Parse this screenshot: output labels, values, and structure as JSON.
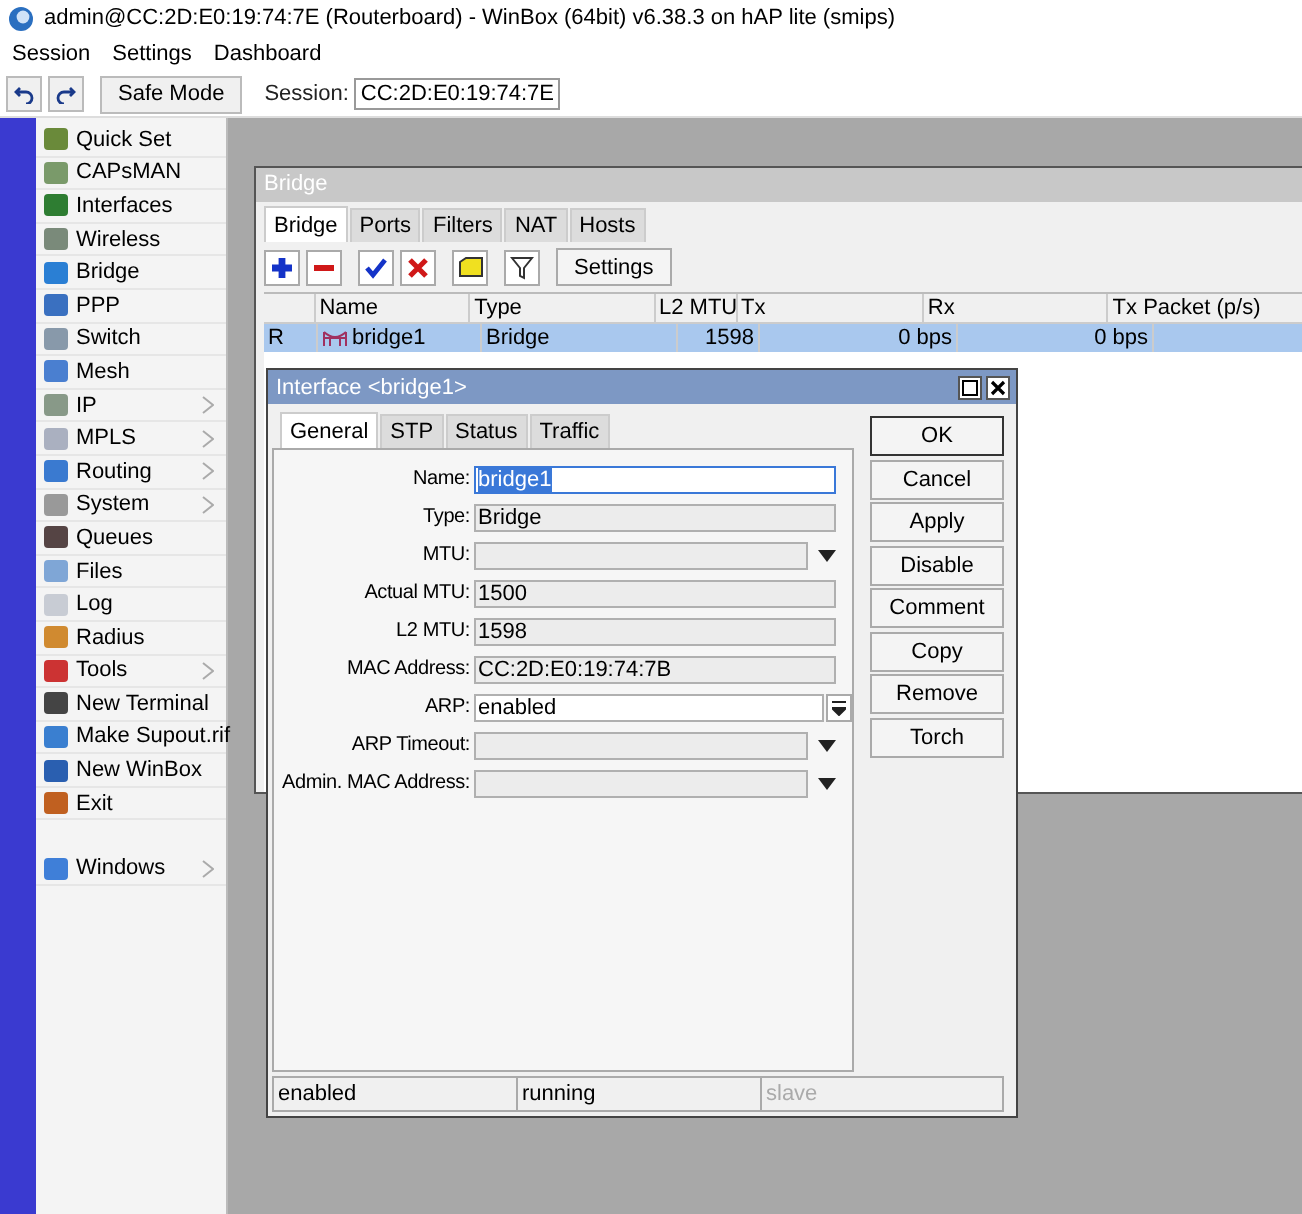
{
  "window": {
    "title": "admin@CC:2D:E0:19:74:7E (Routerboard) - WinBox (64bit) v6.38.3 on hAP lite (smips)"
  },
  "menu": [
    "Session",
    "Settings",
    "Dashboard"
  ],
  "toolbar": {
    "safe_mode": "Safe Mode",
    "session_label": "Session:",
    "session_value": "CC:2D:E0:19:74:7E"
  },
  "sidebar": {
    "items": [
      {
        "label": "Quick Set",
        "submenu": false
      },
      {
        "label": "CAPsMAN",
        "submenu": false
      },
      {
        "label": "Interfaces",
        "submenu": false
      },
      {
        "label": "Wireless",
        "submenu": false
      },
      {
        "label": "Bridge",
        "submenu": false
      },
      {
        "label": "PPP",
        "submenu": false
      },
      {
        "label": "Switch",
        "submenu": false
      },
      {
        "label": "Mesh",
        "submenu": false
      },
      {
        "label": "IP",
        "submenu": true
      },
      {
        "label": "MPLS",
        "submenu": true
      },
      {
        "label": "Routing",
        "submenu": true
      },
      {
        "label": "System",
        "submenu": true
      },
      {
        "label": "Queues",
        "submenu": false
      },
      {
        "label": "Files",
        "submenu": false
      },
      {
        "label": "Log",
        "submenu": false
      },
      {
        "label": "Radius",
        "submenu": false
      },
      {
        "label": "Tools",
        "submenu": true
      },
      {
        "label": "New Terminal",
        "submenu": false
      },
      {
        "label": "Make Supout.rif",
        "submenu": false
      },
      {
        "label": "New WinBox",
        "submenu": false
      },
      {
        "label": "Exit",
        "submenu": false
      }
    ],
    "bottom_items": [
      {
        "label": "Windows",
        "submenu": true
      }
    ]
  },
  "bridge_window": {
    "title": "Bridge",
    "tabs": [
      {
        "label": "Bridge",
        "selected": true
      },
      {
        "label": "Ports",
        "selected": false
      },
      {
        "label": "Filters",
        "selected": false
      },
      {
        "label": "NAT",
        "selected": false
      },
      {
        "label": "Hosts",
        "selected": false
      }
    ],
    "settings_button": "Settings",
    "table": {
      "columns": [
        "Name",
        "Type",
        "L2 MTU",
        "Tx",
        "Rx",
        "Tx Packet (p/s)"
      ],
      "rows": [
        {
          "flag": "R",
          "name": "bridge1",
          "type": "Bridge",
          "l2_mtu": "1598",
          "tx": "0 bps",
          "rx": "0 bps",
          "selected": true
        }
      ]
    }
  },
  "interface_dialog": {
    "title": "Interface <bridge1>",
    "tabs": [
      {
        "label": "General",
        "selected": true
      },
      {
        "label": "STP",
        "selected": false
      },
      {
        "label": "Status",
        "selected": false
      },
      {
        "label": "Traffic",
        "selected": false
      }
    ],
    "fields": [
      {
        "label": "Name:",
        "value": "bridge1",
        "kind": "text",
        "text_selected": true
      },
      {
        "label": "Type:",
        "value": "Bridge",
        "kind": "readonly",
        "text_selected": false
      },
      {
        "label": "MTU:",
        "kind": "optional",
        "text_selected": false
      },
      {
        "label": "Actual MTU:",
        "value": "1500",
        "kind": "readonly",
        "text_selected": false
      },
      {
        "label": "L2 MTU:",
        "value": "1598",
        "kind": "readonly",
        "text_selected": false
      },
      {
        "label": "MAC Address:",
        "value": "CC:2D:E0:19:74:7B",
        "kind": "readonly",
        "text_selected": false
      },
      {
        "label": "ARP:",
        "value": "enabled",
        "kind": "select",
        "text_selected": false
      },
      {
        "label": "ARP Timeout:",
        "kind": "optional",
        "text_selected": false
      },
      {
        "label": "Admin. MAC Address:",
        "kind": "optional",
        "text_selected": false
      }
    ],
    "buttons": [
      {
        "label": "OK",
        "default": true
      },
      {
        "label": "Cancel",
        "default": false
      },
      {
        "label": "Apply",
        "default": false
      },
      {
        "label": "Disable",
        "default": false
      },
      {
        "label": "Comment",
        "default": false
      },
      {
        "label": "Copy",
        "default": false
      },
      {
        "label": "Remove",
        "default": false
      },
      {
        "label": "Torch",
        "default": false
      }
    ],
    "status_bar": [
      {
        "text": "enabled",
        "dimmed": false
      },
      {
        "text": "running",
        "dimmed": false
      },
      {
        "text": "slave",
        "dimmed": true
      }
    ]
  }
}
